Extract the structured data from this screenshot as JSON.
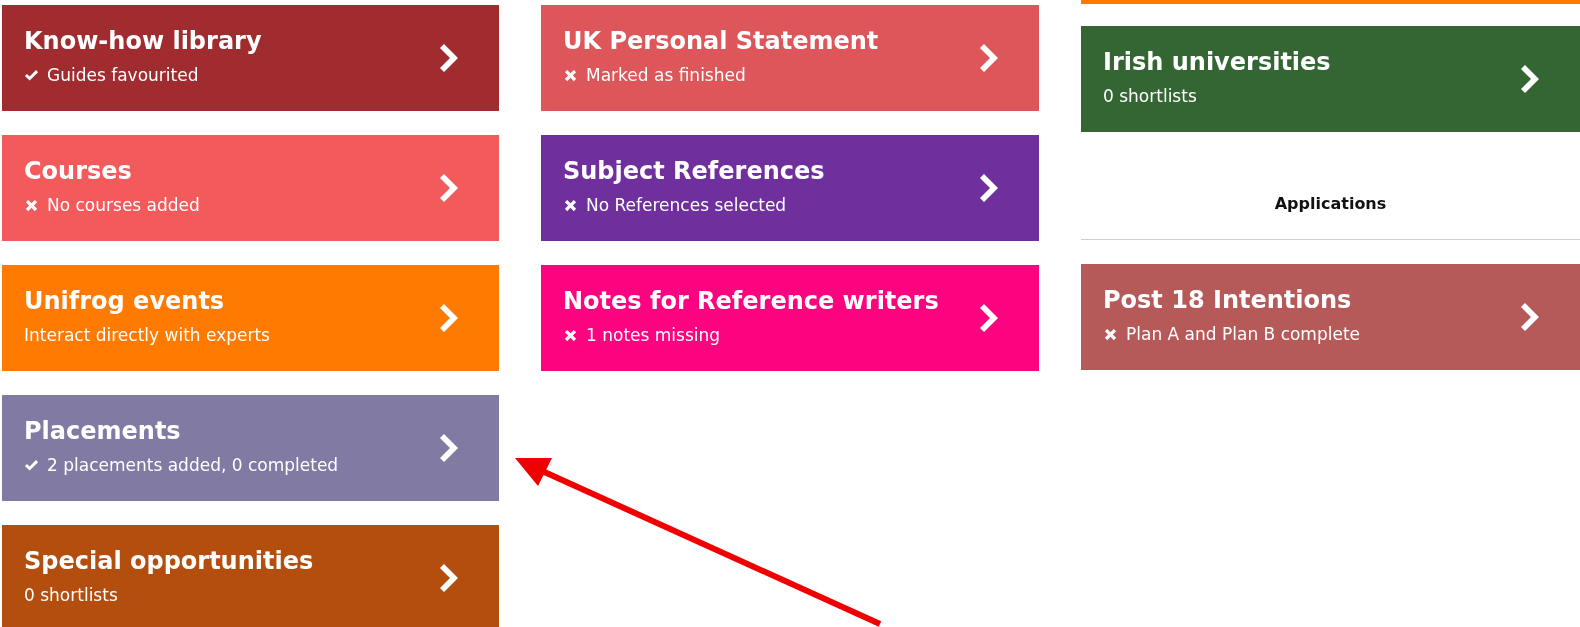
{
  "columns": [
    {
      "items": [
        {
          "kind": "card",
          "title": "Know-how library",
          "complete": true,
          "subtitle": "Guides favourited",
          "color": "#a02c2f"
        },
        {
          "kind": "card",
          "title": "Courses",
          "complete": false,
          "subtitle": "No courses added",
          "color": "#f25a5c"
        },
        {
          "kind": "card",
          "title": "Unifrog events",
          "subtitle": "Interact directly with experts",
          "color": "#ff7a00"
        },
        {
          "kind": "card",
          "title": "Placements",
          "complete": true,
          "subtitle": "2 placements added, 0 completed",
          "color": "#817aa3"
        },
        {
          "kind": "card",
          "title": "Special opportunities",
          "subtitle": "0 shortlists",
          "color": "#b34e0f"
        }
      ]
    },
    {
      "items": [
        {
          "kind": "card",
          "title": "UK Personal Statement",
          "complete": false,
          "subtitle": "Marked as finished",
          "color": "#dc565a"
        },
        {
          "kind": "card",
          "title": "Subject References",
          "complete": false,
          "subtitle": "No References selected",
          "color": "#6f309e"
        },
        {
          "kind": "card",
          "title": "Notes for Reference writers",
          "complete": false,
          "subtitle": "1 notes missing",
          "color": "#fe037f"
        }
      ]
    },
    {
      "items": [
        {
          "kind": "strip",
          "color": "#ff7a00"
        },
        {
          "kind": "card",
          "title": "Irish universities",
          "subtitle": "0 shortlists",
          "color": "#336633"
        },
        {
          "kind": "heading",
          "title": "Applications"
        },
        {
          "kind": "card",
          "title": "Post 18 Intentions",
          "complete": false,
          "subtitle": "Plan A and Plan B complete",
          "color": "#b55a59"
        }
      ]
    }
  ]
}
